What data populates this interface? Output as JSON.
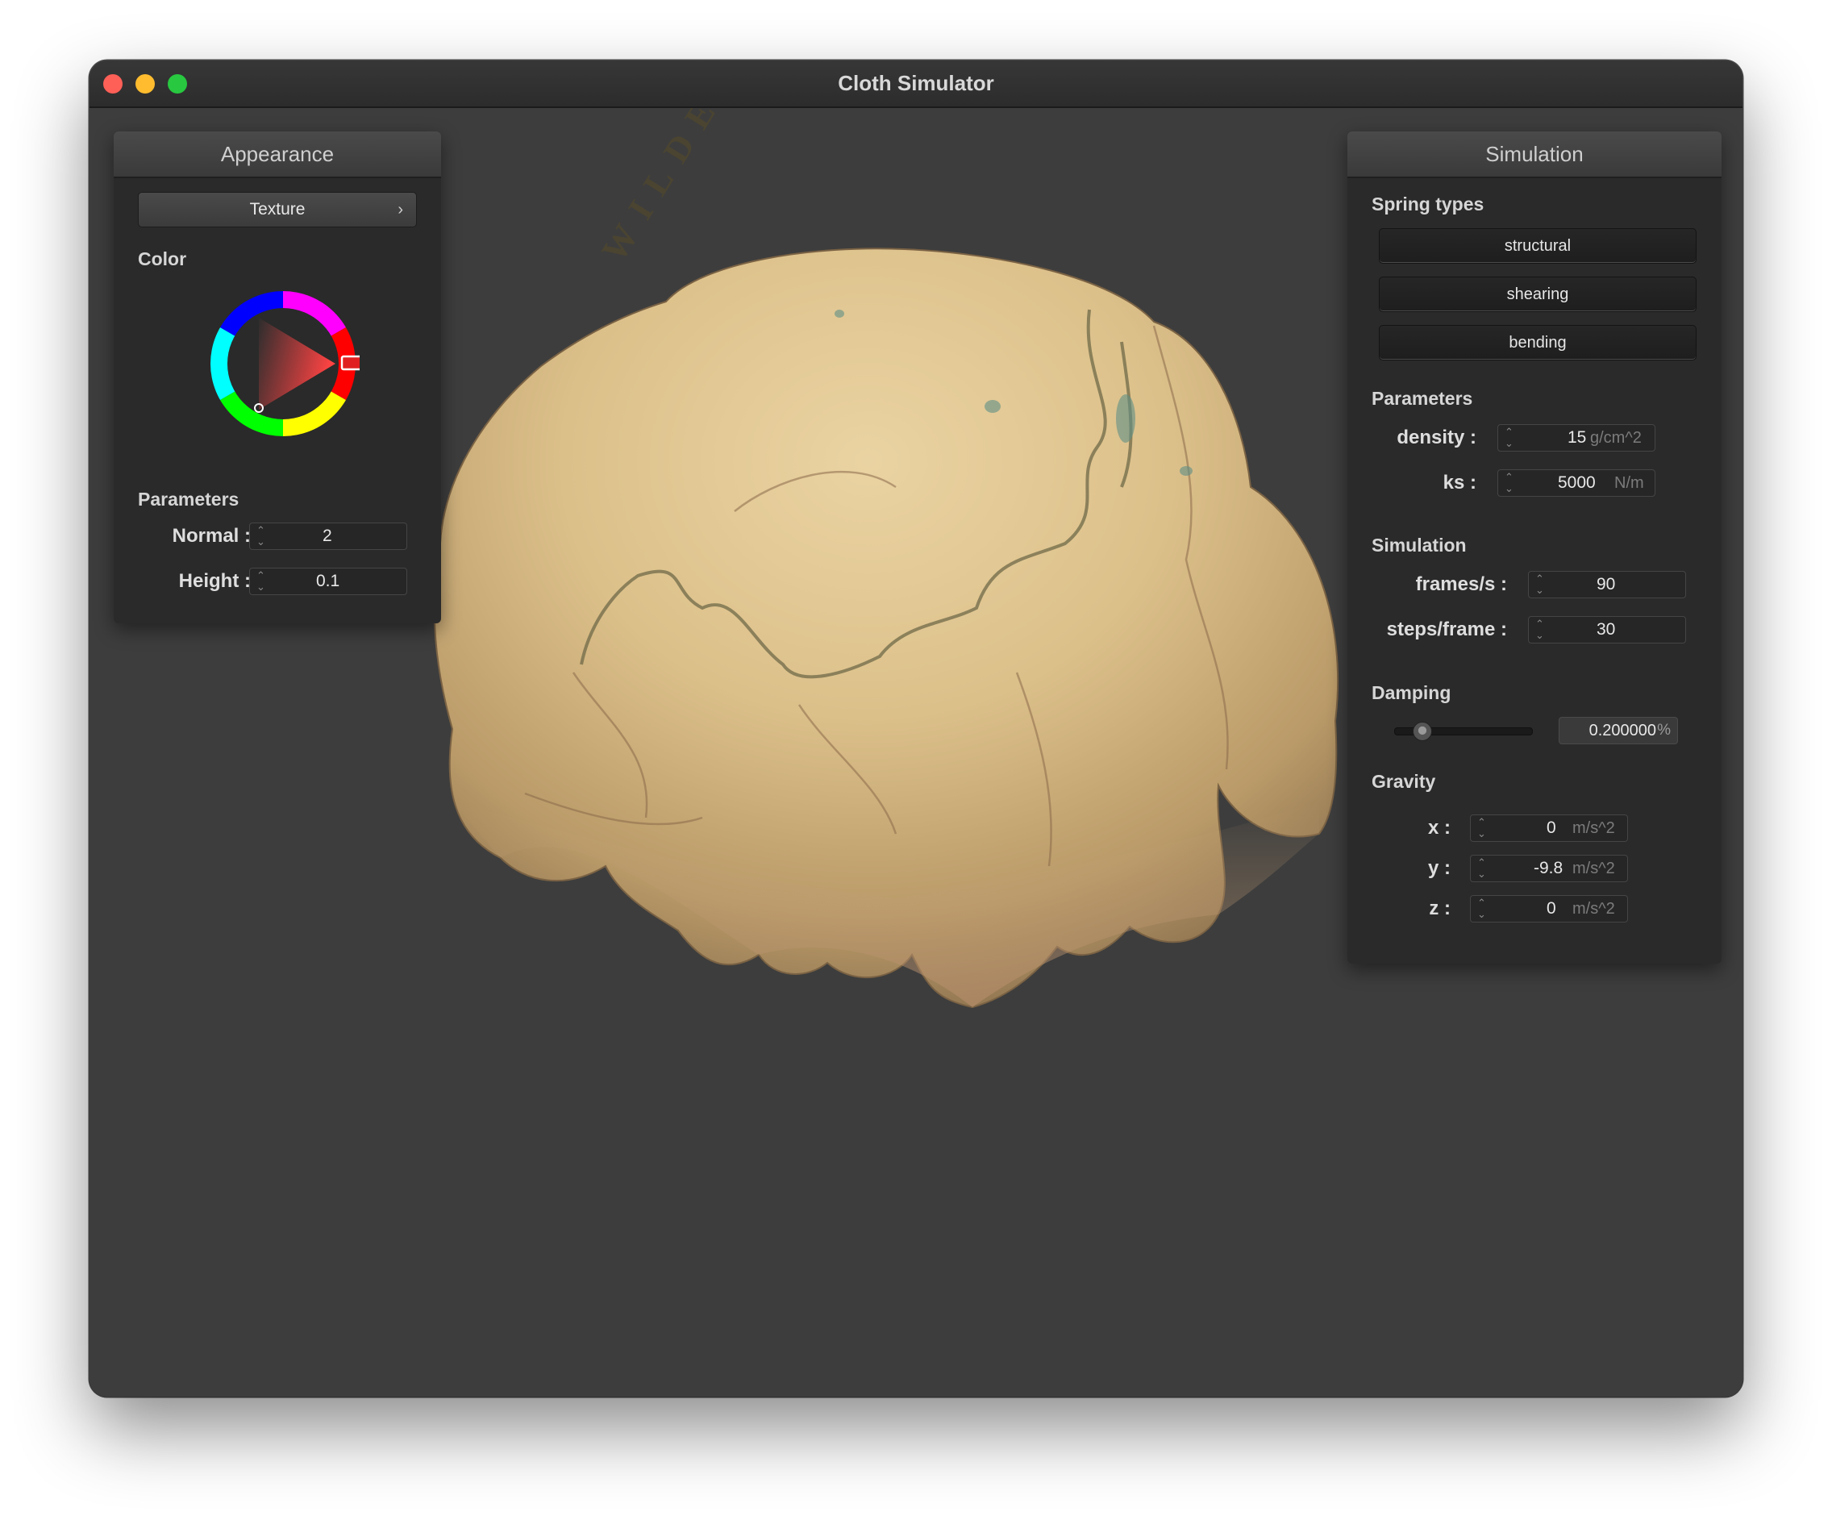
{
  "window": {
    "title": "Cloth Simulator"
  },
  "appearance": {
    "header": "Appearance",
    "texture_button": "Texture",
    "color_label": "Color",
    "params_label": "Parameters",
    "normal": {
      "label": "Normal :",
      "value": "2"
    },
    "height": {
      "label": "Height :",
      "value": "0.1"
    }
  },
  "simulation": {
    "header": "Simulation",
    "spring_types_label": "Spring types",
    "spring_types": [
      "structural",
      "shearing",
      "bending"
    ],
    "params_label": "Parameters",
    "density": {
      "label": "density :",
      "value": "15",
      "unit": "g/cm^2"
    },
    "ks": {
      "label": "ks :",
      "value": "5000",
      "unit": "N/m"
    },
    "sim_label": "Simulation",
    "fps": {
      "label": "frames/s :",
      "value": "90"
    },
    "steps": {
      "label": "steps/frame :",
      "value": "30"
    },
    "damping_label": "Damping",
    "damping": {
      "value": "0.200000",
      "unit": "%",
      "fraction": 0.2
    },
    "gravity_label": "Gravity",
    "gx": {
      "label": "x :",
      "value": "0",
      "unit": "m/s^2"
    },
    "gy": {
      "label": "y :",
      "value": "-9.8",
      "unit": "m/s^2"
    },
    "gz": {
      "label": "z :",
      "value": "0",
      "unit": "m/s^2"
    }
  },
  "colors": {
    "window_bg": "#3d3d3d",
    "cloth": "#d9c08c",
    "selected_color": "#e02020"
  },
  "map_text": "WILDERNESS"
}
